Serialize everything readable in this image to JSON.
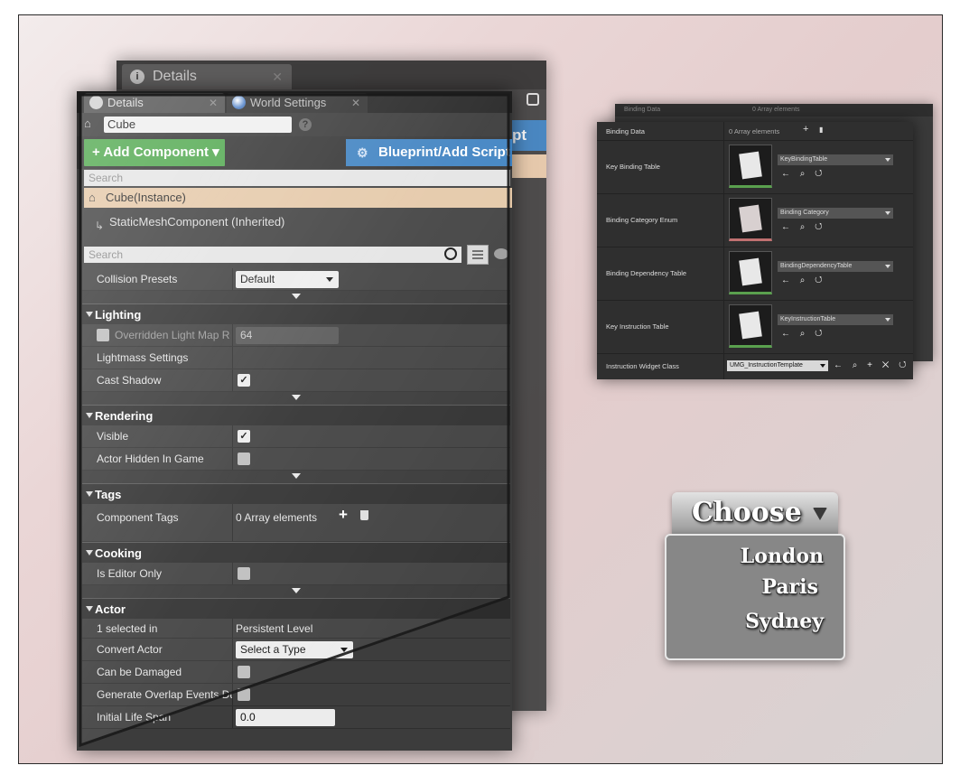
{
  "back_panel": {
    "tab_label": "Details",
    "blueprint_partial": "pt"
  },
  "tabs": [
    {
      "label": "Details"
    },
    {
      "label": "World Settings"
    }
  ],
  "actor_name": "Cube",
  "toolbar": {
    "add_component": "+ Add Component ▾",
    "blueprint_script": "Blueprint/Add Script"
  },
  "component_search_placeholder": "Search",
  "components": [
    {
      "label": "Cube(Instance)",
      "selected": true
    },
    {
      "label": "StaticMeshComponent (Inherited)",
      "selected": false
    }
  ],
  "details_search_placeholder": "Search",
  "details": {
    "collision": {
      "label": "Collision Presets",
      "value": "Default"
    },
    "lighting": {
      "title": "Lighting",
      "override": {
        "label": "Overridden Light Map Re",
        "value": "64",
        "checked": false
      },
      "lightmass": "Lightmass Settings",
      "cast_shadow": {
        "label": "Cast Shadow",
        "checked": true
      }
    },
    "rendering": {
      "title": "Rendering",
      "visible": {
        "label": "Visible",
        "checked": true
      },
      "hidden": {
        "label": "Actor Hidden In Game",
        "checked": false
      }
    },
    "tags": {
      "title": "Tags",
      "component_tags": {
        "label": "Component Tags",
        "value": "0 Array elements"
      }
    },
    "cooking": {
      "title": "Cooking",
      "editor_only": {
        "label": "Is Editor Only",
        "checked": false
      }
    },
    "actor": {
      "title": "Actor",
      "selected_in": {
        "label": "1 selected in",
        "value": "Persistent Level"
      },
      "convert": {
        "label": "Convert Actor",
        "value": "Select a Type"
      },
      "damaged": {
        "label": "Can be Damaged",
        "checked": false
      },
      "overlap": {
        "label": "Generate Overlap Events Dur",
        "checked": false
      },
      "life_span": {
        "label": "Initial Life Span",
        "value": "0.0"
      }
    }
  },
  "binding_panel": {
    "back_header": {
      "label": "Binding Data",
      "value": "0 Array elements"
    },
    "header": {
      "label": "Binding Data",
      "value": "0 Array elements"
    },
    "rows": [
      {
        "label": "Key Binding Table",
        "asset": "KeyBindingTable",
        "thumb_color": "green"
      },
      {
        "label": "Binding Category Enum",
        "asset": "Binding Category",
        "thumb_color": "red"
      },
      {
        "label": "Binding Dependency Table",
        "asset": "BindingDependencyTable",
        "thumb_color": "green"
      },
      {
        "label": "Key Instruction Table",
        "asset": "KeyInstructionTable",
        "thumb_color": "green"
      }
    ],
    "widget_row": {
      "label": "Instruction Widget Class",
      "value": "UMG_InstructionTemplate"
    }
  },
  "dropdown": {
    "label": "Choose",
    "options": [
      "London",
      "Paris",
      "Sydney"
    ]
  }
}
